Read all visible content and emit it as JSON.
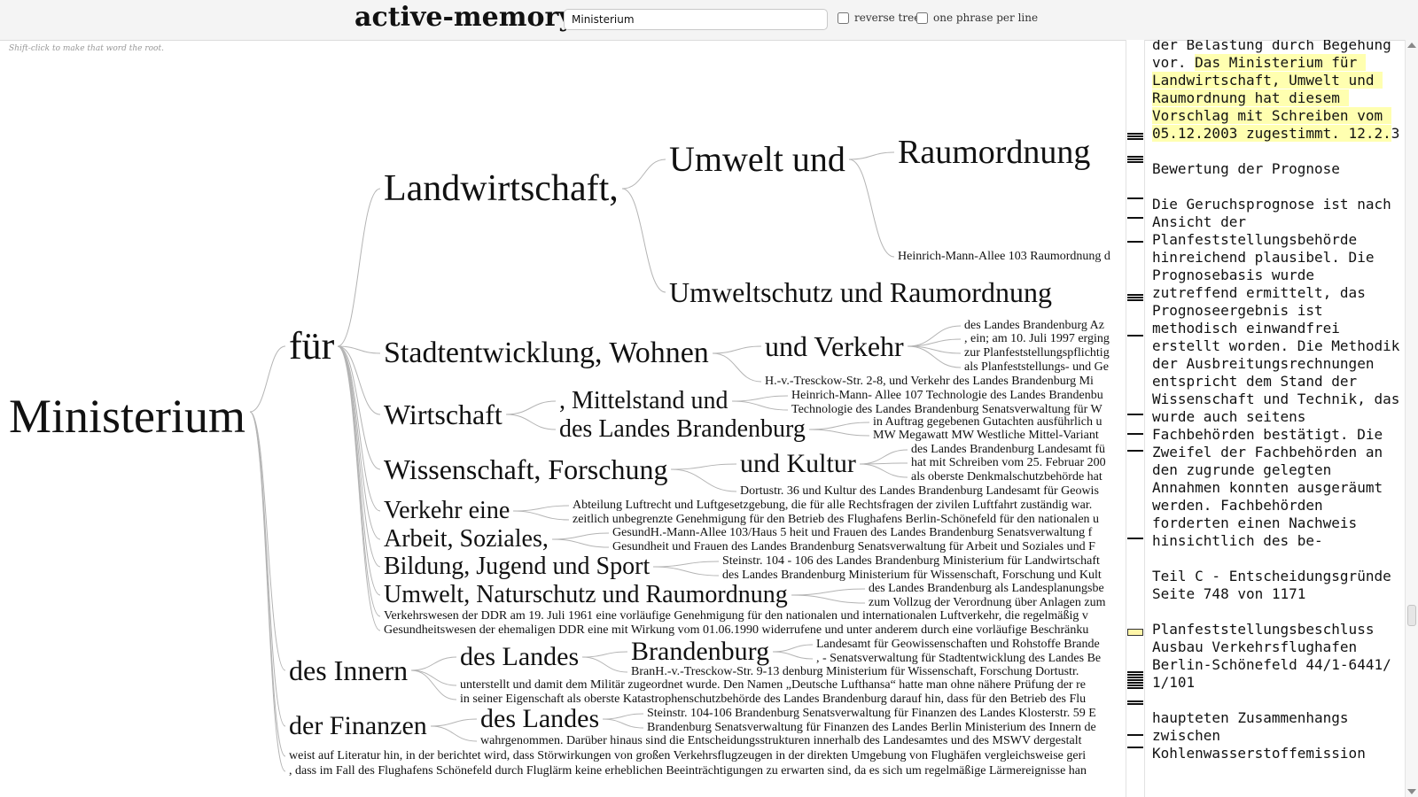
{
  "app": {
    "title": "active-memory"
  },
  "search": {
    "value": "Ministerium",
    "placeholder": ""
  },
  "options": {
    "reverse_tree_label": "reverse tree",
    "one_phrase_label": "one phrase per line"
  },
  "hint": "Shift-click to make that word the root.",
  "tree": {
    "root": "Ministerium",
    "nodes": [
      "für",
      "Landwirtschaft,",
      "Umwelt und",
      "Raumordnung",
      "Heinrich-Mann-Allee 103 Raumordnung d",
      "Umweltschutz und Raumordnung",
      "Stadtentwicklung, Wohnen",
      "und Verkehr",
      "des Landes Brandenburg Az",
      ", ein; am 10. Juli 1997 erging",
      "zur Planfeststellungspflichtig",
      "als Planfeststellungs- und Ge",
      "H.-v.-Tresckow-Str. 2-8, und Verkehr des Landes Brandenburg Mi",
      "Wirtschaft",
      ", Mittelstand und",
      "Heinrich-Mann- Allee 107 Technologie des Landes Brandenbu",
      "Technologie des Landes Brandenburg Senatsverwaltung für W",
      "des Landes Brandenburg",
      "in Auftrag gegebenen Gutachten ausführlich u",
      "MW Megawatt MW Westliche Mittel-Variant",
      "Wissenschaft, Forschung",
      "und Kultur",
      "des Landes Brandenburg Landesamt fü",
      "hat mit Schreiben vom 25. Februar 200",
      "als oberste Denkmalschutzbehörde hat",
      "Dortustr. 36 und Kultur des Landes Brandenburg Landesamt für Geowis",
      "Verkehr eine",
      "Abteilung Luftrecht und Luftgesetzgebung, die für alle Rechtsfragen der zivilen Luftfahrt zuständig war.",
      "zeitlich unbegrenzte Genehmigung für den Betrieb des Flughafens Berlin-Schönefeld für den nationalen u",
      "Arbeit, Soziales,",
      "GesundH.-Mann-Allee 103/Haus 5 heit und Frauen des Landes Brandenburg Senatsverwaltung f",
      "Gesundheit und Frauen des Landes Brandenburg Senatsverwaltung für Arbeit und Soziales und F",
      "Bildung, Jugend und Sport",
      "Steinstr. 104 - 106 des Landes Brandenburg Ministerium für Landwirtschaft",
      "des Landes Brandenburg Ministerium für Wissenschaft, Forschung und Kult",
      "Umwelt, Naturschutz und Raumordnung",
      "des Landes Brandenburg als Landesplanungsbe",
      "zum Vollzug der Verordnung über Anlagen zum",
      "Verkehrswesen der DDR am 19. Juli 1961 eine vorläufige Genehmigung für den nationalen und internationalen Luftverkehr, die regelmäßig v",
      "Gesundheitswesen der ehemaligen DDR eine mit Wirkung vom 01.06.1990 widerrufene und unter anderem durch eine vorläufige Beschränku",
      "des Innern",
      "des Landes",
      "Brandenburg",
      "Landesamt für Geowissenschaften und Rohstoffe Brande",
      ", - Senatsverwaltung für Stadtentwicklung des Landes Be",
      "BranH.-v.-Tresckow-Str. 9-13 denburg Ministerium für Wissenschaft, Forschung Dortustr.",
      "unterstellt und damit dem Militär zugeordnet wurde. Den Namen „Deutsche Lufthansa“ hatte man ohne nähere Prüfung der re",
      "in seiner Eigenschaft als oberste Katastrophenschutzbehörde des Landes Brandenburg darauf hin, dass für den Betrieb des Flu",
      "der Finanzen",
      "des Landes",
      "Steinstr. 104-106 Brandenburg Senatsverwaltung für Finanzen des Landes Klosterstr. 59 E",
      "Brandenburg Senatsverwaltung für Finanzen des Landes Berlin Ministerium des Innern de",
      "wahrgenommen. Darüber hinaus sind die Entscheidungsstrukturen innerhalb des Landesamtes und des MSWV dergestalt",
      "weist auf Literatur hin, in der berichtet wird, dass Störwirkungen von großen Verkehrsflugzeugen in der direkten Umgebung von Flughäfen vergleichsweise geri",
      ", dass im Fall des Flughafens Schönefeld durch Fluglärm keine erheblichen Beeinträchtigungen zu erwarten sind, da es sich um regelmäßige Lärmereignisse han"
    ]
  },
  "document": {
    "text_before": "der Belastung durch Begehung\nvor. ",
    "highlight": "Das Ministerium für Landwirtschaft, Umwelt und Raumordnung hat diesem Vorschlag mit Schreiben vom 05.12.2003 zugestimmt. 12.2.",
    "text_after": "3\n\nBewertung der Prognose\n\nDie Geruchsprognose ist nach Ansicht der Planfeststellungsbehörde hinreichend plausibel. Die Prognosebasis wurde zutreffend ermittelt, das Prognoseergebnis ist methodisch einwandfrei erstellt worden. Die Methodik der Ausbreitungsrechnungen entspricht dem Stand der Wissenschaft und Technik, das wurde auch seitens Fachbehörden bestätigt. Die Zweifel der Fachbehörden an den zugrunde gelegten Annahmen konnten ausgeräumt werden. Fachbehörden forderten einen Nachweis hinsichtlich des be-\n\nTeil C - Entscheidungsgründe\nSeite 748 von 1171\n\nPlanfeststellungsbeschluss\nAusbau Verkehrsflughafen\nBerlin-Schönefeld 44/1-6441/\n1/101\n\nhaupteten Zusammenhangs\nzwischen\nKohlenwasserstoffemission"
  },
  "colors": {
    "highlight": "#ffffb0",
    "link_stroke": "#b4b4b4",
    "topbar": "#f4f4f4"
  }
}
